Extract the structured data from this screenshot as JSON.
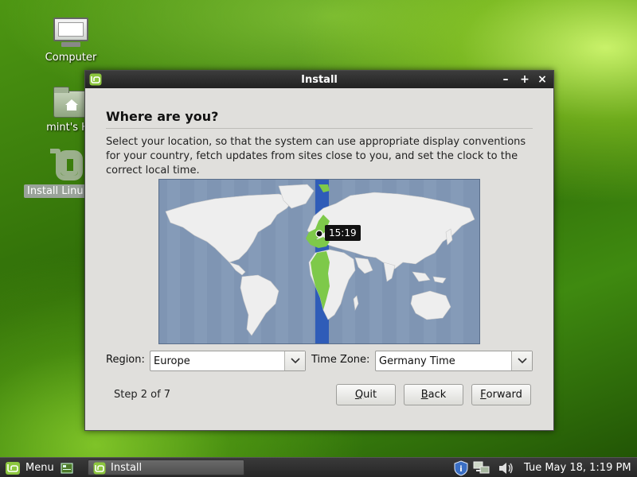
{
  "desktop": {
    "icons": [
      {
        "label": "Computer"
      },
      {
        "label": "mint's Ho"
      },
      {
        "label": "Install Linu"
      }
    ]
  },
  "window": {
    "title": "Install",
    "controls": {
      "minimize": "–",
      "maximize": "+",
      "close": "×"
    },
    "heading": "Where are you?",
    "description": "Select your location, so that the system can use appropriate display conventions for your country, fetch updates from sites close to you, and set the clock to the correct local time.",
    "map": {
      "time_label": "15:19"
    },
    "region_label": "Region:",
    "region_value": "Europe",
    "timezone_label": "Time Zone:",
    "timezone_value": "Germany Time",
    "step": "Step 2 of 7",
    "buttons": {
      "quit": {
        "mnemonic": "Q",
        "rest": "uit"
      },
      "back": {
        "mnemonic": "B",
        "rest": "ack"
      },
      "forward": {
        "mnemonic": "F",
        "rest": "orward"
      }
    }
  },
  "taskbar": {
    "menu_label": "Menu",
    "task_label": "Install",
    "clock": "Tue May 18,  1:19 PM"
  },
  "colors": {
    "titlebar": "#2b2b2b",
    "dialog_bg": "#e0dfdc",
    "map_ocean": "#7f95b3",
    "timezone_highlight": "#2f5cb8",
    "country_highlight": "#7ec94a"
  }
}
